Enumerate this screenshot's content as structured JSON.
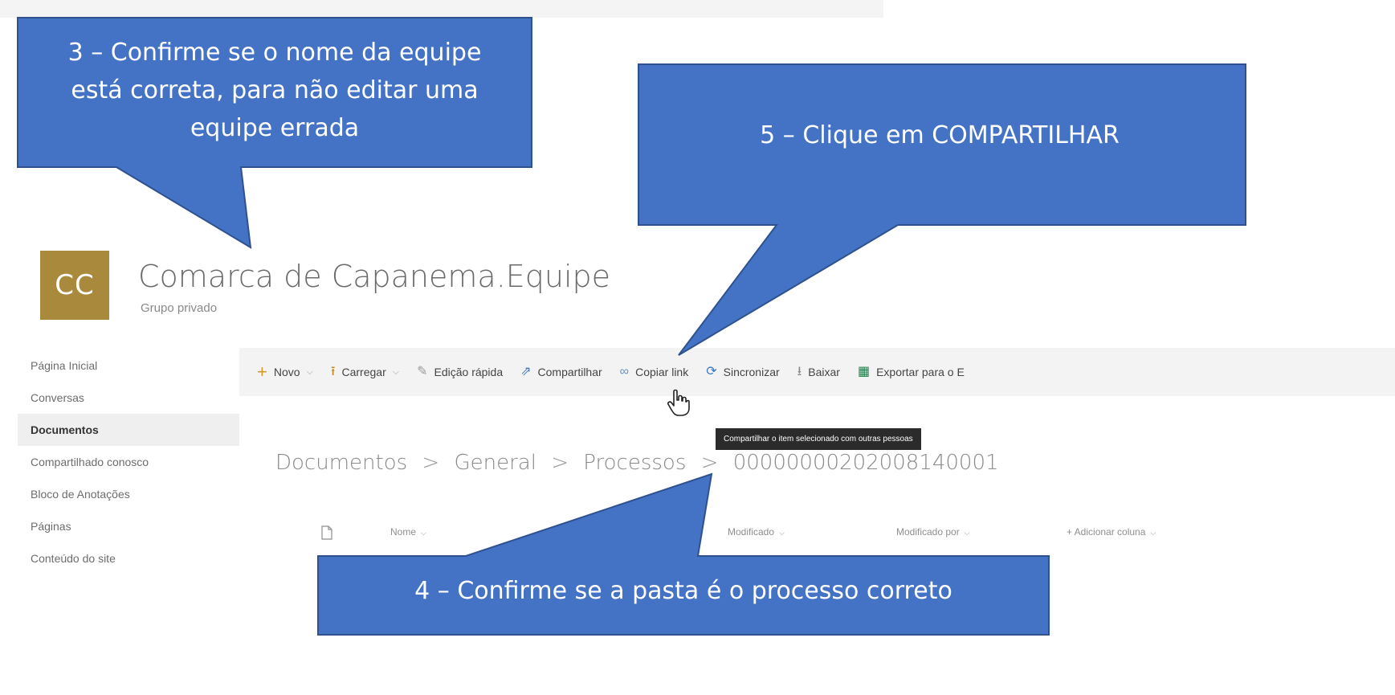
{
  "site": {
    "logo_initials": "CC",
    "title": "Comarca de Capanema.Equipe",
    "subtitle": "Grupo privado",
    "logo_color": "#a9893c"
  },
  "nav": {
    "items": [
      {
        "label": "Página Inicial",
        "selected": false
      },
      {
        "label": "Conversas",
        "selected": false
      },
      {
        "label": "Documentos",
        "selected": true
      },
      {
        "label": "Compartilhado conosco",
        "selected": false
      },
      {
        "label": "Bloco de Anotações",
        "selected": false
      },
      {
        "label": "Páginas",
        "selected": false
      },
      {
        "label": "Conteúdo do site",
        "selected": false
      }
    ]
  },
  "commandbar": {
    "new_label": "Novo",
    "upload_label": "Carregar",
    "quick_edit_label": "Edição rápida",
    "share_label": "Compartilhar",
    "copy_link_label": "Copiar link",
    "sync_label": "Sincronizar",
    "download_label": "Baixar",
    "export_label": "Exportar para o E",
    "icons": {
      "new": "plus-icon",
      "upload": "upload-arrow-icon",
      "quick_edit": "pencil-icon",
      "share": "share-icon",
      "copy_link": "link-icon",
      "sync": "sync-icon",
      "download": "download-arrow-icon",
      "export": "excel-icon"
    }
  },
  "tooltip": {
    "text": "Compartilhar o item selecionado com outras pessoas"
  },
  "breadcrumb": {
    "items": [
      "Documentos",
      "General",
      "Processos",
      "00000000202008140001"
    ],
    "separator": ">"
  },
  "columns": {
    "name": "Nome",
    "modified": "Modificado",
    "modified_by": "Modificado por",
    "add_column": "+ Adicionar coluna"
  },
  "callouts": {
    "step3": {
      "line1": "3 – Confirme se o nome da equipe",
      "line2": "está correta, para não editar uma",
      "line3": "equipe errada"
    },
    "step5": {
      "line1": "5 – Clique em COMPARTILHAR"
    },
    "step4": {
      "line1": "4 – Confirme se a pasta é o processo correto"
    },
    "fill_color": "#4472c4",
    "border_color": "#2f528f"
  }
}
